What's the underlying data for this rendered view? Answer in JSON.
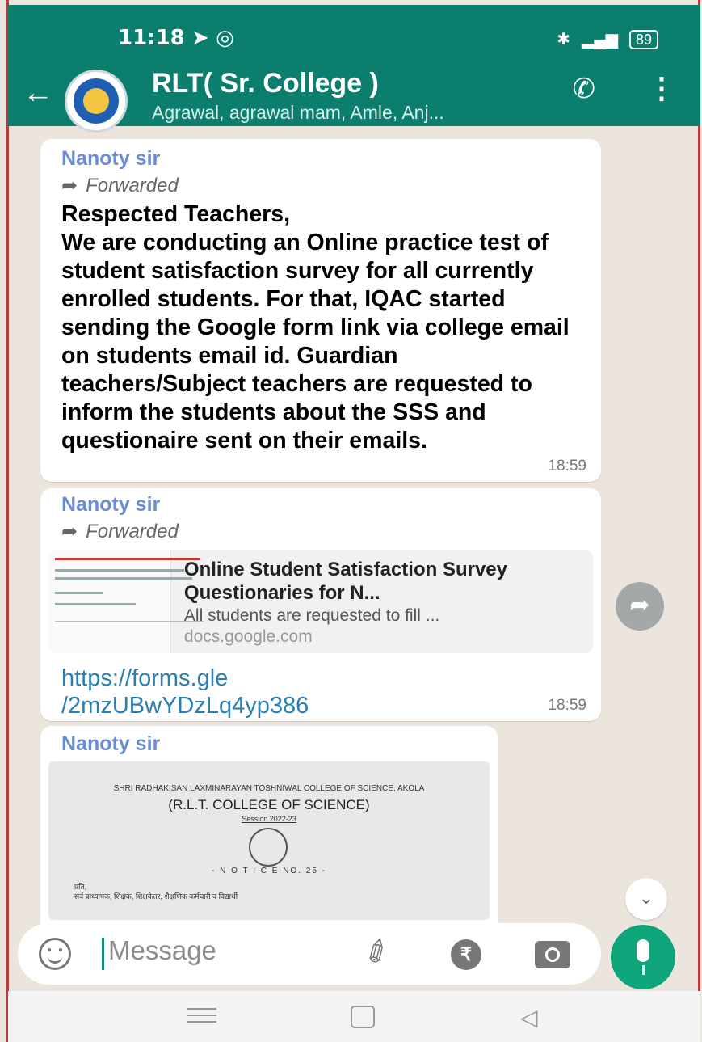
{
  "status_bar": {
    "time": "11:18",
    "battery": "89"
  },
  "header": {
    "title": "RLT( Sr. College )",
    "subtitle": "Agrawal, agrawal mam, Amle, Anj..."
  },
  "messages": [
    {
      "sender": "Nanoty sir",
      "forwarded_label": "Forwarded",
      "body": "Respected Teachers,\nWe are conducting an Online practice test of student satisfaction survey for all currently enrolled students. For that, IQAC started sending the Google form link via college email on students email id. Guardian teachers/Subject teachers are requested to inform the students about the SSS and questionaire sent on their emails.",
      "time": "18:59"
    },
    {
      "sender": "Nanoty sir",
      "forwarded_label": "Forwarded",
      "link_preview": {
        "title": "Online Student Satisfaction Survey Questionaries for N...",
        "description": "All students are requested to fill ...",
        "domain": "docs.google.com"
      },
      "url": "https://forms.gle\n/2mzUBwYDzLq4yp386",
      "time": "18:59"
    },
    {
      "sender": "Nanoty sir",
      "image_doc": {
        "college_name": "SHRI RADHAKISAN LAXMINARAYAN TOSHNIWAL COLLEGE OF SCIENCE, AKOLA",
        "short_name": "(R.L.T. COLLEGE OF SCIENCE)",
        "session": "Session 2022-23",
        "notice": "- N O T I C E NO. 25 -",
        "to": "प्रति,",
        "recipients": "सर्व प्राध्यापक, शिक्षक, शिक्षकेतर, शैक्षणिक कर्मचारी व विद्यार्थी"
      }
    }
  ],
  "input": {
    "placeholder": "Message"
  },
  "icons": {
    "back": "back-arrow-icon",
    "call": "add-call-icon",
    "menu": "more-vert-icon",
    "emoji": "emoji-icon",
    "attach": "paperclip-icon",
    "rupee": "rupee-icon",
    "camera": "camera-icon",
    "mic": "mic-icon",
    "share": "share-forward-icon",
    "scroll": "chevron-double-down-icon"
  },
  "colors": {
    "header": "#0b7e6e",
    "chat_bg": "#ece5dd",
    "bubble": "#ffffff",
    "sender": "#6a8cd4",
    "link": "#2a7fb0",
    "mic_button": "#0fa57a"
  }
}
